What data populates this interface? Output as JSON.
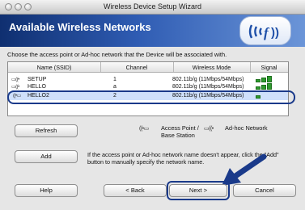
{
  "window": {
    "title": "Wireless Device Setup Wizard"
  },
  "header": {
    "title": "Available Wireless Networks"
  },
  "instruction": "Choose the access point or Ad-hoc network that the Device will be associated with.",
  "table": {
    "columns": [
      "Name (SSID)",
      "Channel",
      "Wireless Mode",
      "Signal"
    ],
    "rows": [
      {
        "name": "SETUP",
        "channel": "1",
        "mode": "802.11b/g (11Mbps/54Mbps)",
        "signal": 3,
        "selected": false
      },
      {
        "name": "HELLO",
        "channel": "a",
        "mode": "802.11b/g (11Mbps/54Mbps)",
        "signal": 3,
        "selected": false
      },
      {
        "name": "HELLO2",
        "channel": "2",
        "mode": "802.11b/g (11Mbps/54Mbps)",
        "signal": 1,
        "selected": true
      }
    ]
  },
  "buttons": {
    "refresh": "Refresh",
    "add": "Add",
    "help": "Help",
    "back": "< Back",
    "next": "Next >",
    "cancel": "Cancel"
  },
  "legend": {
    "access_point_line1": "Access Point /",
    "access_point_line2": "Base Station",
    "adhoc": "Ad-hoc Network"
  },
  "note": "If the access point or Ad-hoc network name doesn't appear, click the \"Add\" button to manually specify the network name.",
  "colors": {
    "header_dark": "#0f2f70",
    "header_light": "#6b95d8",
    "highlight": "#1a3a8a",
    "signal": "#2e9a2e"
  },
  "icons": [
    "window-close-icon",
    "window-minimize-icon",
    "window-zoom-icon",
    "wireless-logo-icon",
    "access-point-icon",
    "adhoc-network-icon",
    "signal-icon",
    "pointer-arrow-icon"
  ]
}
